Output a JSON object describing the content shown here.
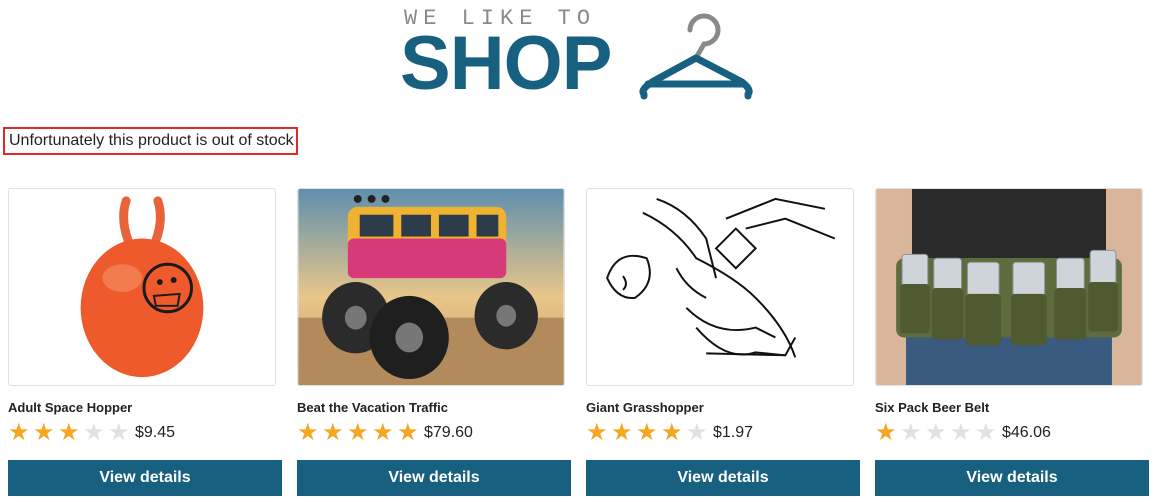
{
  "logo": {
    "tagline": "WE LIKE TO",
    "wordmark": "SHOP"
  },
  "notice": {
    "text": "Unfortunately this product is out of stock"
  },
  "colors": {
    "brand": "#17607f",
    "alert_border": "#e02a2a",
    "star_on": "#f5a623",
    "star_off": "#dfe3e8"
  },
  "products": [
    {
      "name": "Adult Space Hopper",
      "rating": 3,
      "max_rating": 5,
      "price": "$9.45",
      "button": "View details",
      "image_icon": "space-hopper-image"
    },
    {
      "name": "Beat the Vacation Traffic",
      "rating": 5,
      "max_rating": 5,
      "price": "$79.60",
      "button": "View details",
      "image_icon": "monster-van-image"
    },
    {
      "name": "Giant Grasshopper",
      "rating": 4,
      "max_rating": 5,
      "price": "$1.97",
      "button": "View details",
      "image_icon": "grasshopper-sketch-image"
    },
    {
      "name": "Six Pack Beer Belt",
      "rating": 1,
      "max_rating": 5,
      "price": "$46.06",
      "button": "View details",
      "image_icon": "beer-belt-image"
    }
  ]
}
